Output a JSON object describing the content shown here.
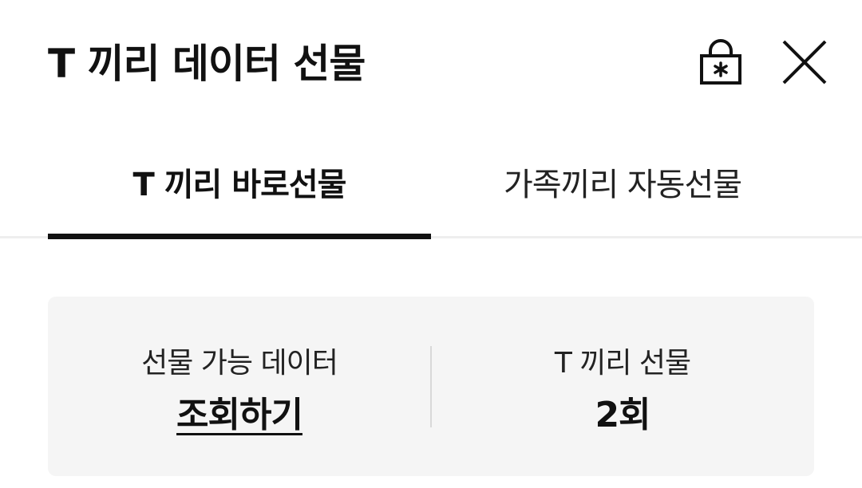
{
  "header": {
    "title": "T 끼리 데이터 선물",
    "lock_icon": "lock-asterisk-icon",
    "close_icon": "close-icon"
  },
  "tabs": [
    {
      "label": "T 끼리 바로선물",
      "active": true
    },
    {
      "label": "가족끼리 자동선물",
      "active": false
    }
  ],
  "summary": {
    "gift_available_label": "선물 가능 데이터",
    "gift_available_action": "조회하기",
    "gift_count_label": "T 끼리 선물",
    "gift_count_value": "2회"
  },
  "colors": {
    "text": "#111111",
    "card_bg": "#f5f5f5",
    "tab_indicator": "#111111",
    "divider": "#d9d9d9"
  }
}
